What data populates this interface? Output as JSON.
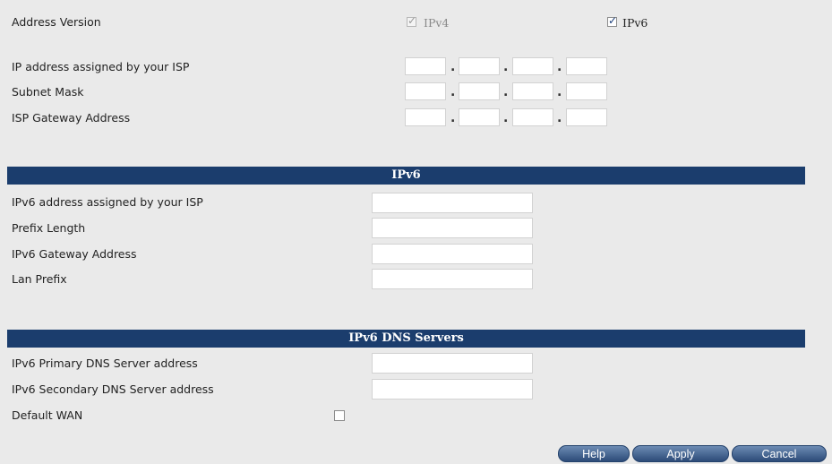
{
  "address_version": {
    "label": "Address Version",
    "ipv4_label": "IPv4",
    "ipv4_checked": true,
    "ipv4_disabled": true,
    "ipv6_label": "IPv6",
    "ipv6_checked": true
  },
  "ipv4": {
    "ip_label": "IP address assigned by your ISP",
    "subnet_label": "Subnet Mask",
    "gateway_label": "ISP Gateway Address",
    "ip_value": [
      "",
      "",
      "",
      ""
    ],
    "subnet_value": [
      "",
      "",
      "",
      ""
    ],
    "gateway_value": [
      "",
      "",
      "",
      ""
    ]
  },
  "ipv6_section": {
    "title": "IPv6",
    "address_label": "IPv6 address assigned by your ISP",
    "address_value": "",
    "prefix_length_label": "Prefix Length",
    "prefix_length_value": "",
    "gateway_label": "IPv6 Gateway Address",
    "gateway_value": "",
    "lan_prefix_label": "Lan Prefix",
    "lan_prefix_value": ""
  },
  "dns_section": {
    "title": "IPv6 DNS Servers",
    "primary_label": "IPv6 Primary DNS Server address",
    "primary_value": "",
    "secondary_label": "IPv6 Secondary DNS Server address",
    "secondary_value": "",
    "default_wan_label": "Default WAN",
    "default_wan_checked": false
  },
  "buttons": {
    "help": "Help",
    "apply": "Apply",
    "cancel": "Cancel"
  }
}
